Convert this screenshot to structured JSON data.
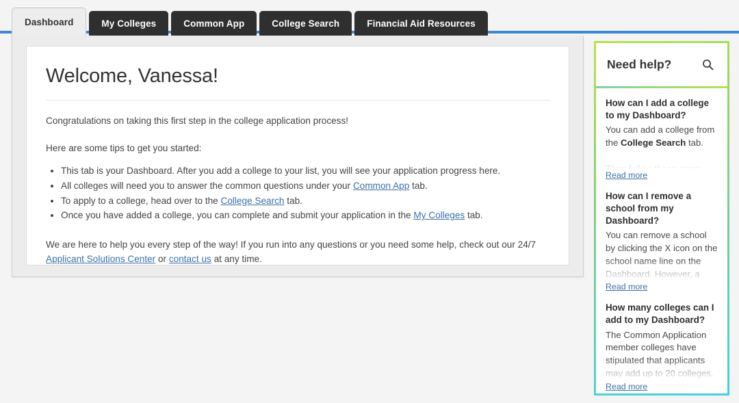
{
  "tabs": [
    {
      "label": "Dashboard",
      "active": true
    },
    {
      "label": "My Colleges",
      "active": false
    },
    {
      "label": "Common App",
      "active": false
    },
    {
      "label": "College Search",
      "active": false
    },
    {
      "label": "Financial Aid Resources",
      "active": false
    }
  ],
  "main": {
    "heading": "Welcome, Vanessa!",
    "intro": "Congratulations on taking this first step in the college application process!",
    "tips_lead": "Here are some tips to get you started:",
    "tips": [
      {
        "before": "This tab is your Dashboard. After you add a college to your list, you will see your application progress here.",
        "link": "",
        "after": ""
      },
      {
        "before": "All colleges will need you to answer the common questions under your ",
        "link": "Common App",
        "after": " tab."
      },
      {
        "before": "To apply to a college, head over to the ",
        "link": "College Search",
        "after": " tab."
      },
      {
        "before": "Once you have added a college, you can complete and submit your application in the ",
        "link": "My Colleges",
        "after": " tab."
      }
    ],
    "closing": {
      "part1": "We are here to help you every step of the way! If you run into any questions or you need some help, check out our 24/7 ",
      "link1": "Applicant Solutions Center",
      "part2": " or ",
      "link2": "contact us",
      "part3": " at any time."
    }
  },
  "sidebar": {
    "title": "Need help?",
    "search_icon": "search-icon",
    "read_more_label": "Read more",
    "faqs": [
      {
        "question": "How can I add a college to my Dashboard?",
        "answer_part1": "You can add a college from the ",
        "answer_bold": "College Search",
        "answer_part2": " tab.",
        "answer_faded": "Then follow these steps:"
      },
      {
        "question": "How can I remove a school from my Dashboard?",
        "answer_part1": "You can remove a school by clicking the X icon on the school name line on the ",
        "answer_bold": "",
        "answer_part2": "",
        "answer_faded": "Dashboard. However, a"
      },
      {
        "question": "How many colleges can I add to my Dashboard?",
        "answer_part1": "The Common Application member colleges have stipulated that applicants ",
        "answer_bold": "",
        "answer_part2": "",
        "answer_faded": "may add up to 20 colleges."
      }
    ]
  },
  "colors": {
    "tab_active_bg": "#ededed",
    "tab_inactive_bg": "#2f2f2f",
    "accent_blue": "#3b87d4",
    "link_blue": "#3b6fa8",
    "sidebar_gradient_start": "#b6e34a",
    "sidebar_gradient_end": "#3fd0e8",
    "page_bg": "#f4f4f4"
  }
}
